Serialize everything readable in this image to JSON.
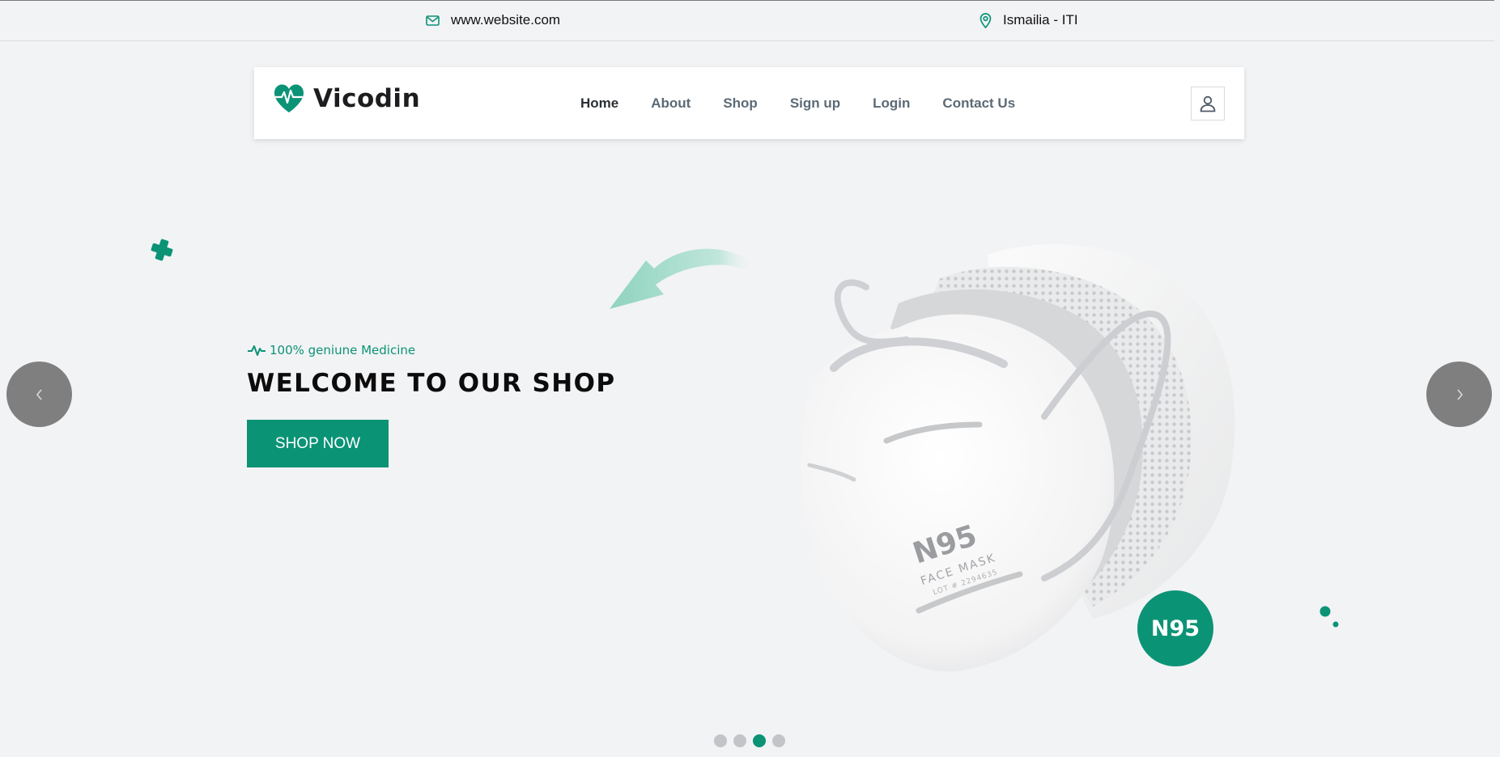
{
  "topbar": {
    "email": "www.website.com",
    "location": "Ismailia - ITI",
    "email_icon": "mail-icon",
    "location_icon": "map-pin-icon"
  },
  "navbar": {
    "brand": "Vicodin",
    "brand_icon": "heart-pulse-icon",
    "menu": [
      "Home",
      "About",
      "Shop",
      "Sign up",
      "Login",
      "Contact Us"
    ],
    "active_item": "Home",
    "user_icon": "user-icon"
  },
  "hero": {
    "tagline": "100% geniune Medicine",
    "headline": "WELCOME TO OUR SHOP",
    "cta": "SHOP NOW",
    "badge": "N95",
    "mask_print_1": "N95",
    "mask_print_2": "FACE MASK",
    "mask_print_3": "LOT # 2294635"
  },
  "carousel": {
    "prev_icon": "chevron-left-icon",
    "next_icon": "chevron-right-icon",
    "slide_count": 4,
    "active_slide": 3
  },
  "colors": {
    "accent": "#0b9376",
    "background": "#f2f3f5",
    "arrow_bg": "#7f7f7f",
    "dot_inactive": "#c2c4c7"
  }
}
